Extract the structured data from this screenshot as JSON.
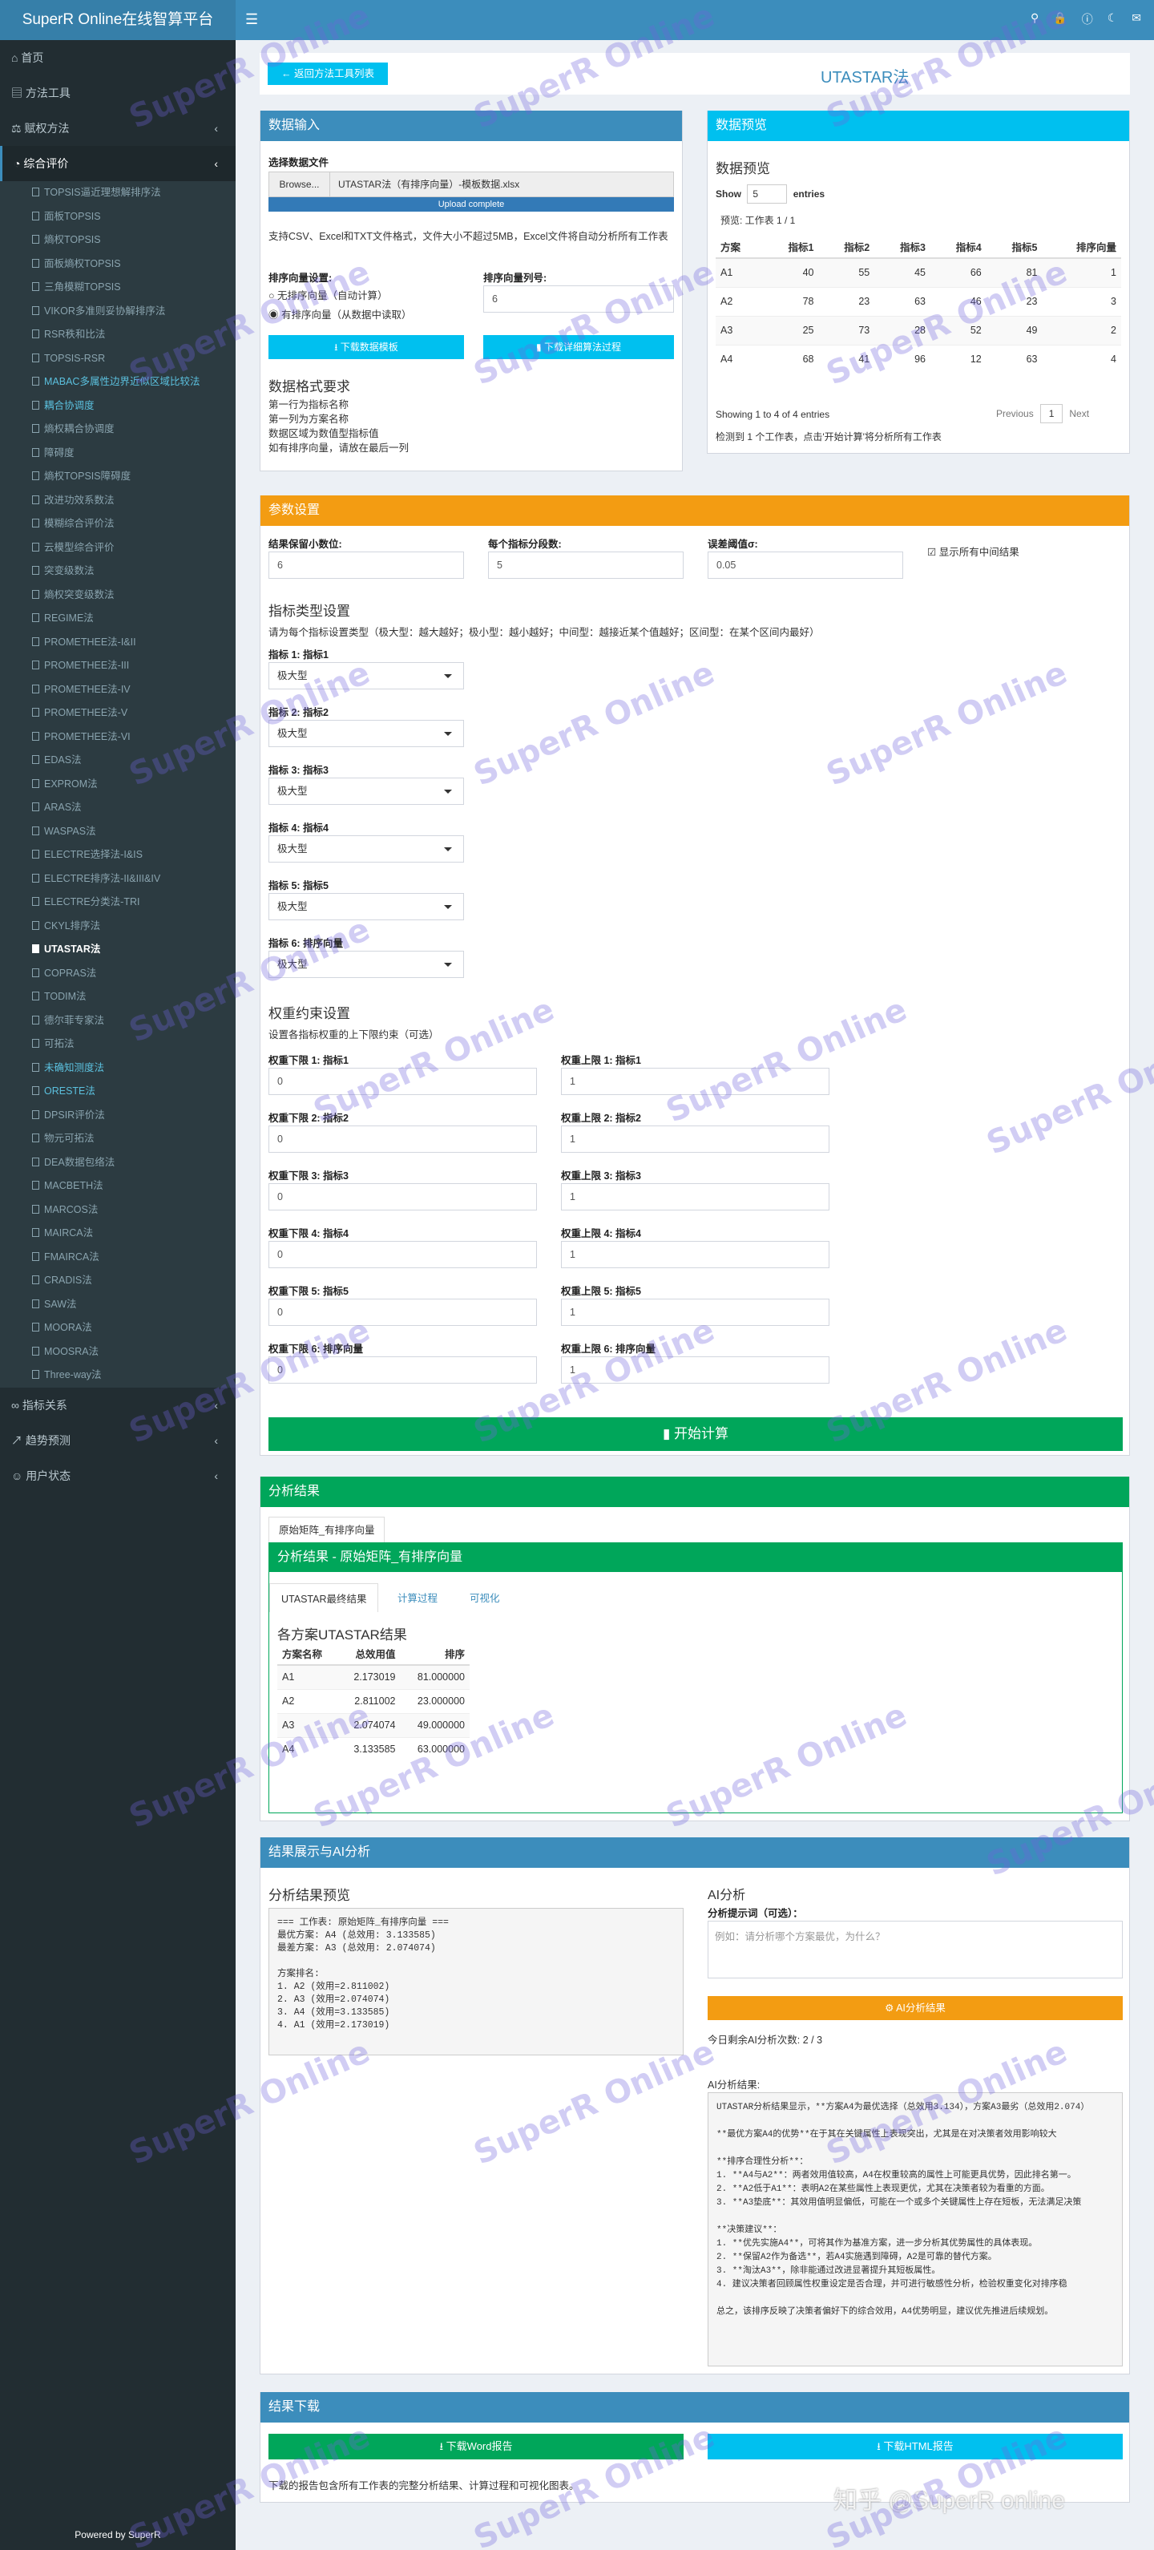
{
  "app_title": "SuperR Online在线智算平台",
  "powered": "Powered by SuperR",
  "sidebar": {
    "top_items": [
      {
        "label": "首页",
        "icon": "home-icon",
        "chev": false
      },
      {
        "label": "方法工具",
        "icon": "briefcase-icon",
        "chev": false
      },
      {
        "label": "赋权方法",
        "icon": "balance-icon",
        "chev": true
      },
      {
        "label": "综合评价",
        "icon": "chart-icon",
        "chev": true
      }
    ],
    "sub_items": [
      "TOPSIS逼近理想解排序法",
      "面板TOPSIS",
      "熵权TOPSIS",
      "面板熵权TOPSIS",
      "三角模糊TOPSIS",
      "VIKOR多准则妥协解排序法",
      "RSR秩和比法",
      "TOPSIS-RSR",
      "MABAC多属性边界近似区域比较法",
      "耦合协调度",
      "熵权耦合协调度",
      "障碍度",
      "熵权TOPSIS障碍度",
      "改进功效系数法",
      "模糊综合评价法",
      "云模型综合评价",
      "突变级数法",
      "熵权突变级数法",
      "REGIME法",
      "PROMETHEE法-I&II",
      "PROMETHEE法-III",
      "PROMETHEE法-IV",
      "PROMETHEE法-V",
      "PROMETHEE法-VI",
      "EDAS法",
      "EXPROM法",
      "ARAS法",
      "WASPAS法",
      "ELECTRE选择法-I&IS",
      "ELECTRE排序法-II&III&IV",
      "ELECTRE分类法-TRI",
      "CKYL排序法",
      "UTASTAR法",
      "COPRAS法",
      "TODIM法",
      "德尔菲专家法",
      "可拓法",
      "未确知测度法",
      "ORESTE法",
      "DPSIR评价法",
      "物元可拓法",
      "DEA数据包络法",
      "MACBETH法",
      "MARCOS法",
      "MAIRCA法",
      "FMAIRCA法",
      "CRADIS法",
      "SAW法",
      "MOORA法",
      "MOOSRA法",
      "Three-way法"
    ],
    "bottom_items": [
      {
        "label": "指标关系",
        "icon": "link-icon"
      },
      {
        "label": "趋势预测",
        "icon": "trend-icon"
      },
      {
        "label": "用户状态",
        "icon": "user-icon"
      }
    ]
  },
  "header": {
    "back_label": "返回方法工具列表",
    "page_title": "UTASTAR法"
  },
  "data_input": {
    "title": "数据输入",
    "file_label": "选择数据文件",
    "browse": "Browse...",
    "file_name": "UTASTAR法（有排序向量）-模板数据.xlsx",
    "upload_status": "Upload complete",
    "help": "支持CSV、Excel和TXT文件格式，文件大小不超过5MB，Excel文件将自动分析所有工作表",
    "rank_setting": "排序向量设置:",
    "radio1": "无排序向量（自动计算）",
    "radio2": "有排序向量（从数据中读取）",
    "rank_col_label": "排序向量列号:",
    "rank_col_value": "6",
    "btn_template": "下载数据模板",
    "btn_process": "下载详细算法过程",
    "format_title": "数据格式要求",
    "format_lines": [
      "第一行为指标名称",
      "第一列为方案名称",
      "数据区域为数值型指标值",
      "如有排序向量，请放在最后一列"
    ]
  },
  "preview": {
    "title": "数据预览",
    "heading": "数据预览",
    "show": "Show",
    "entries_value": "5",
    "entries": "entries",
    "sheet": "预览: 工作表 1 / 1",
    "columns": [
      "方案",
      "指标1",
      "指标2",
      "指标3",
      "指标4",
      "指标5",
      "排序向量"
    ],
    "rows": [
      [
        "A1",
        "40",
        "55",
        "45",
        "66",
        "81",
        "1"
      ],
      [
        "A2",
        "78",
        "23",
        "63",
        "46",
        "23",
        "3"
      ],
      [
        "A3",
        "25",
        "73",
        "28",
        "52",
        "49",
        "2"
      ],
      [
        "A4",
        "68",
        "41",
        "96",
        "12",
        "63",
        "4"
      ]
    ],
    "showing": "Showing 1 to 4 of 4 entries",
    "prev": "Previous",
    "page": "1",
    "next": "Next",
    "note": "检测到 1 个工作表，点击'开始计算'将分析所有工作表"
  },
  "params": {
    "title": "参数设置",
    "decimal_label": "结果保留小数位:",
    "decimal_value": "6",
    "seg_label": "每个指标分段数:",
    "seg_value": "5",
    "err_label": "误差阈值σ:",
    "err_value": "0.05",
    "show_mid": "显示所有中间结果",
    "type_title": "指标类型设置",
    "type_desc": "请为每个指标设置类型（极大型：越大越好；极小型：越小越好；中间型：越接近某个值越好；区间型：在某个区间内最好）",
    "indicators": [
      {
        "label": "指标 1: 指标1",
        "value": "极大型"
      },
      {
        "label": "指标 2: 指标2",
        "value": "极大型"
      },
      {
        "label": "指标 3: 指标3",
        "value": "极大型"
      },
      {
        "label": "指标 4: 指标4",
        "value": "极大型"
      },
      {
        "label": "指标 5: 指标5",
        "value": "极大型"
      },
      {
        "label": "指标 6: 排序向量",
        "value": "极大型"
      }
    ],
    "weight_title": "权重约束设置",
    "weight_desc": "设置各指标权重的上下限约束（可选）",
    "weights": [
      {
        "lo_label": "权重下限 1: 指标1",
        "lo": "0",
        "hi_label": "权重上限 1: 指标1",
        "hi": "1"
      },
      {
        "lo_label": "权重下限 2: 指标2",
        "lo": "0",
        "hi_label": "权重上限 2: 指标2",
        "hi": "1"
      },
      {
        "lo_label": "权重下限 3: 指标3",
        "lo": "0",
        "hi_label": "权重上限 3: 指标3",
        "hi": "1"
      },
      {
        "lo_label": "权重下限 4: 指标4",
        "lo": "0",
        "hi_label": "权重上限 4: 指标4",
        "hi": "1"
      },
      {
        "lo_label": "权重下限 5: 指标5",
        "lo": "0",
        "hi_label": "权重上限 5: 指标5",
        "hi": "1"
      },
      {
        "lo_label": "权重下限 6: 排序向量",
        "lo": "0",
        "hi_label": "权重上限 6: 排序向量",
        "hi": "1"
      }
    ],
    "start": "开始计算"
  },
  "results": {
    "title": "分析结果",
    "sheet_tab": "原始矩阵_有排序向量",
    "inner_title": "分析结果 - 原始矩阵_有排序向量",
    "tabs": [
      "UTASTAR最终结果",
      "计算过程",
      "可视化"
    ],
    "table_title": "各方案UTASTAR结果",
    "columns": [
      "方案名称",
      "总效用值",
      "排序"
    ],
    "rows": [
      [
        "A1",
        "2.173019",
        "81.000000"
      ],
      [
        "A2",
        "2.811002",
        "23.000000"
      ],
      [
        "A3",
        "2.074074",
        "49.000000"
      ],
      [
        "A4",
        "3.133585",
        "63.000000"
      ]
    ]
  },
  "ai": {
    "title": "结果展示与AI分析",
    "preview_title": "分析结果预览",
    "preview_text": "=== 工作表: 原始矩阵_有排序向量 ===\n最优方案: A4 (总效用: 3.133585)\n最差方案: A3 (总效用: 2.074074)\n\n方案排名:\n1. A2 (效用=2.811002)\n2. A3 (效用=2.074074)\n3. A4 (效用=3.133585)\n4. A1 (效用=2.173019)",
    "ai_title": "AI分析",
    "prompt_label": "分析提示词（可选）：",
    "prompt_placeholder": "例如：请分析哪个方案最优，为什么？",
    "ai_button": "AI分析结果",
    "remaining": "今日剩余AI分析次数: 2 / 3",
    "ai_result_label": "AI分析结果:",
    "ai_text": "UTASTAR分析结果显示，**方案A4为最优选择（总效用3.134），方案A3最劣（总效用2.074）\n\n**最优方案A4的优势**在于其在关键属性上表现突出，尤其是在对决策者效用影响较大\n\n**排序合理性分析**：\n1. **A4与A2**：两者效用值较高，A4在权重较高的属性上可能更具优势，因此排名第一。\n2. **A2低于A1**：表明A2在某些属性上表现更优，尤其在决策者较为看重的方面。\n3. **A3垫底**：其效用值明显偏低，可能在一个或多个关键属性上存在短板，无法满足决策\n\n**决策建议**：\n1. **优先实施A4**，可将其作为基准方案，进一步分析其优势属性的具体表现。\n2. **保留A2作为备选**，若A4实施遇到障碍，A2是可靠的替代方案。\n3. **淘汰A3**，除非能通过改进显著提升其短板属性。\n4. 建议决策者回顾属性权重设定是否合理，并可进行敏感性分析，检验权重变化对排序稳\n\n总之，该排序反映了决策者偏好下的综合效用，A4优势明显，建议优先推进后续规划。"
  },
  "download": {
    "title": "结果下载",
    "word": "下载Word报告",
    "html": "下载HTML报告",
    "note": "下载的报告包含所有工作表的完整分析结果、计算过程和可视化图表。"
  },
  "watermark": "SuperR Online",
  "footer_mark": "知乎 @SuperR online"
}
